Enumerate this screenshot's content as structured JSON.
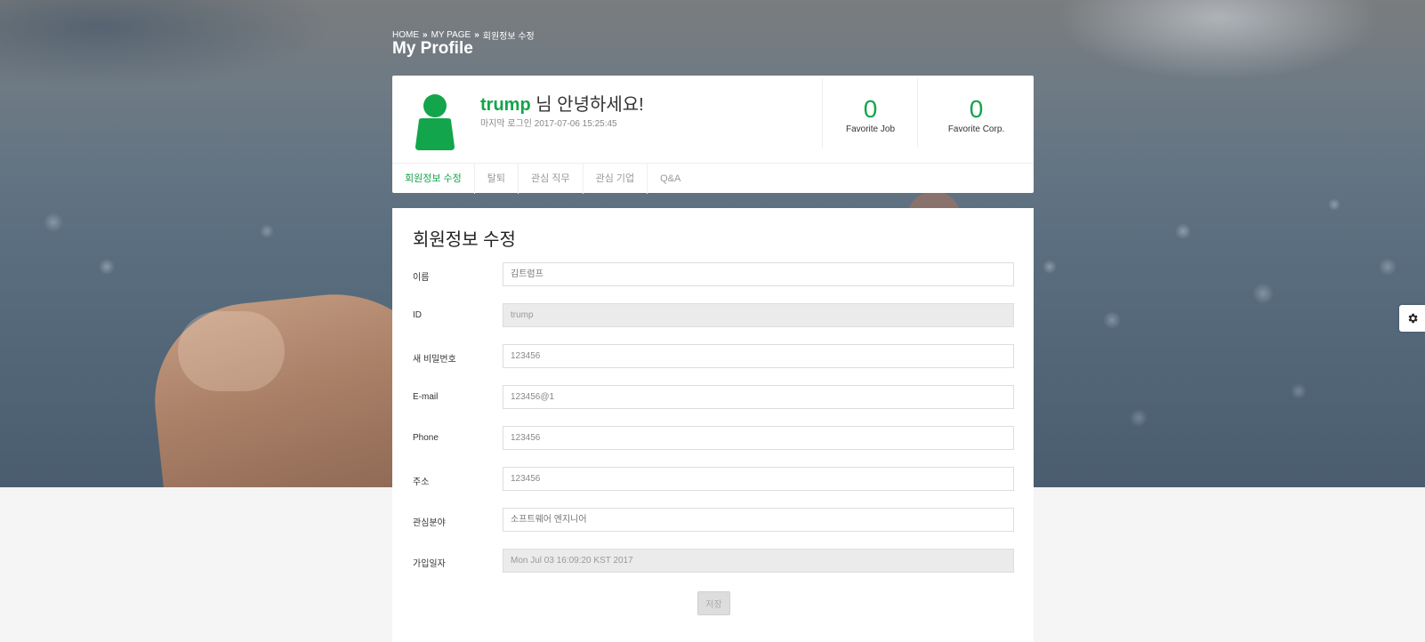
{
  "breadcrumb": {
    "home": "HOME",
    "sep": "»",
    "mypage": "MY PAGE",
    "current": "회원정보 수정"
  },
  "page_title": "My Profile",
  "profile": {
    "username": "trump",
    "greeting_suffix": " 님 안녕하세요!",
    "last_login": "마지막 로그인 2017-07-06 15:25:45"
  },
  "stats": [
    {
      "value": "0",
      "label": "Favorite Job"
    },
    {
      "value": "0",
      "label": "Favorite Corp."
    }
  ],
  "tabs": [
    {
      "label": "회원정보 수정",
      "active": true
    },
    {
      "label": "탈퇴",
      "active": false
    },
    {
      "label": "관심 직무",
      "active": false
    },
    {
      "label": "관심 기업",
      "active": false
    },
    {
      "label": "Q&A",
      "active": false
    }
  ],
  "form": {
    "title": "회원정보 수정",
    "fields": [
      {
        "label": "이름",
        "placeholder": "김트럼프",
        "value": "",
        "disabled": false
      },
      {
        "label": "ID",
        "placeholder": "",
        "value": "trump",
        "disabled": true
      },
      {
        "label": "새 비밀번호",
        "placeholder": "",
        "value": "123456",
        "disabled": false
      },
      {
        "label": "E-mail",
        "placeholder": "",
        "value": "123456@1",
        "disabled": false
      },
      {
        "label": "Phone",
        "placeholder": "",
        "value": "123456",
        "disabled": false
      },
      {
        "label": "주소",
        "placeholder": "",
        "value": "123456",
        "disabled": false
      },
      {
        "label": "관심분야",
        "placeholder": "소프트웨어 엔지니어",
        "value": "",
        "disabled": false
      },
      {
        "label": "가입일자",
        "placeholder": "",
        "value": "Mon Jul 03 16:09:20 KST 2017",
        "disabled": true
      }
    ],
    "save_label": "저장"
  },
  "colors": {
    "accent": "#13a54b"
  },
  "icons": {
    "avatar": "user-icon",
    "settings": "gear-icon"
  }
}
